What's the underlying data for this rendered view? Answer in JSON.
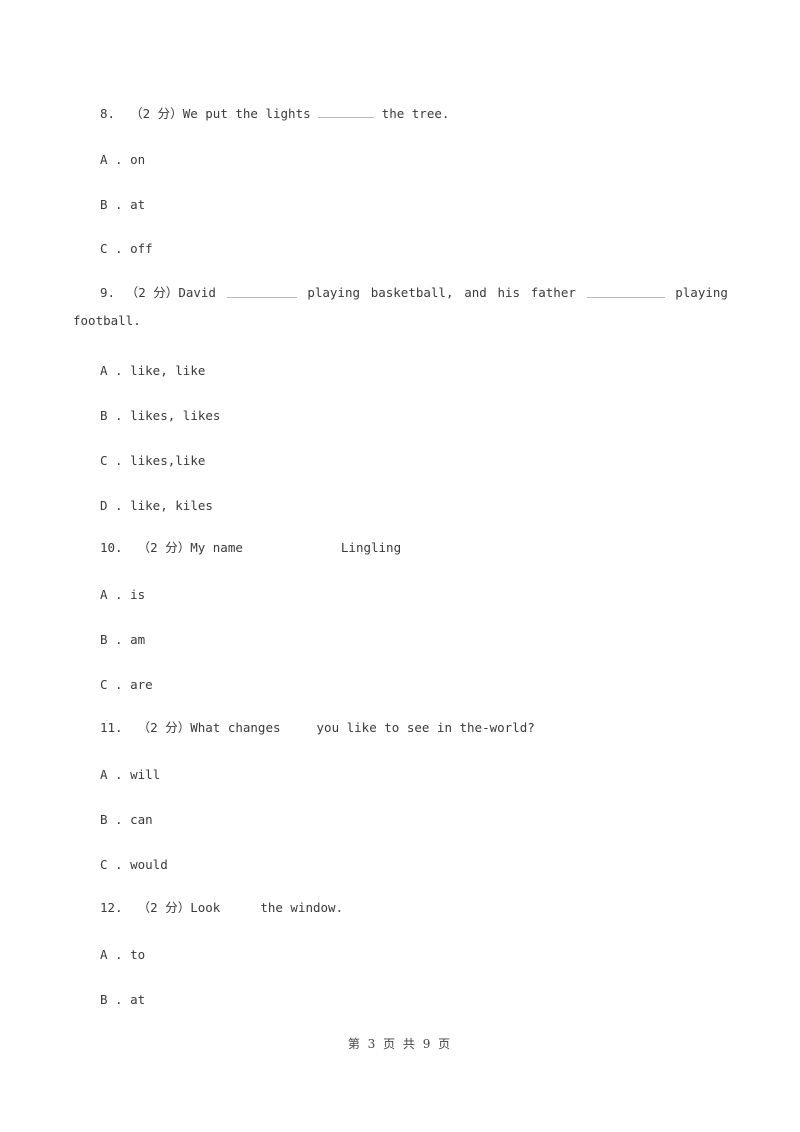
{
  "questions": [
    {
      "number": "8.",
      "score": "（2 分）",
      "stem_before": "We put the lights ",
      "stem_after": " the tree.",
      "options": [
        {
          "letter": "A .",
          "text": "on"
        },
        {
          "letter": "B .",
          "text": "at"
        },
        {
          "letter": "C .",
          "text": "off"
        }
      ]
    },
    {
      "number": "9.",
      "score": "（2 分）",
      "stem_parts": [
        "David",
        "playing",
        "basketball,",
        "and",
        "his",
        "father",
        "playing"
      ],
      "stem_continuation": "football.",
      "options": [
        {
          "letter": "A .",
          "text": "like, like"
        },
        {
          "letter": "B .",
          "text": "likes, likes"
        },
        {
          "letter": "C .",
          "text": "likes,like"
        },
        {
          "letter": "D .",
          "text": "like, kiles"
        }
      ]
    },
    {
      "number": "10.",
      "score": "（2 分）",
      "stem_before": "My name",
      "stem_after": "Lingling",
      "options": [
        {
          "letter": "A .",
          "text": "is"
        },
        {
          "letter": "B .",
          "text": "am"
        },
        {
          "letter": "C .",
          "text": "are"
        }
      ]
    },
    {
      "number": "11.",
      "score": "（2 分）",
      "stem_before": "What changes",
      "stem_after": "you like to see in the-world?",
      "options": [
        {
          "letter": "A .",
          "text": "will"
        },
        {
          "letter": "B .",
          "text": "can"
        },
        {
          "letter": "C .",
          "text": "would"
        }
      ]
    },
    {
      "number": "12.",
      "score": "（2 分）",
      "stem_before": "Look",
      "stem_after": "the window.",
      "options": [
        {
          "letter": "A .",
          "text": "to"
        },
        {
          "letter": "B .",
          "text": "at"
        }
      ]
    }
  ],
  "footer": {
    "page_label": "第 3 页 共 9 页"
  }
}
